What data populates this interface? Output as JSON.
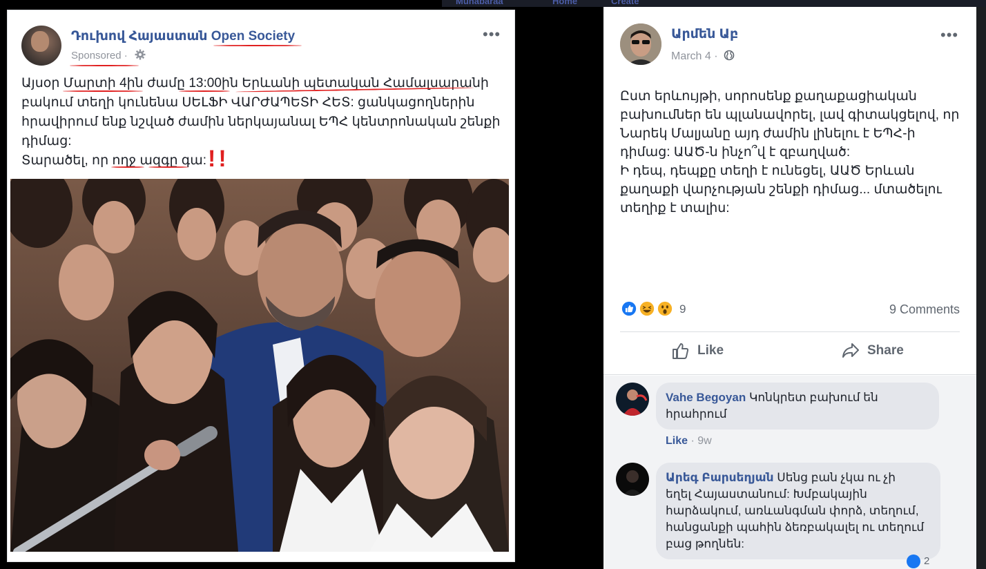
{
  "background_nav": {
    "items": [
      "Muhabaraa",
      "Home",
      "Create"
    ]
  },
  "left_post": {
    "page_name_part1": "Դուխով Հայաստան",
    "page_name_part2": "Open Society",
    "sponsored": "Sponsored",
    "sponsored_sep": "·",
    "more": "•••",
    "text_lines": [
      "Այսօր Մարտի 4ին ժամը 13:00ին Երևանի պետական Համալսարանի",
      "բակում տեղի կունենա ՍԵԼՖԻ ՎԱՐԺԱՊԵՏԻ ՀԵՏ: ցանկացողներին",
      "հրավիրում ենք նշված ժամին ներկայանալ ԵՊՀ կենտրոնական շենքի",
      "դիմաց:",
      "Տարածել, որ ողջ ազգը գա:"
    ],
    "exclamation": "!!",
    "annotation_color": "#e02020"
  },
  "right_post": {
    "author": "Արմեն Աբ",
    "date": "March 4",
    "date_sep": "·",
    "more": "•••",
    "text_lines": [
      "Ըստ երևույթի, սորոսենք քաղաքացիական",
      "բախումներ են պլանավորել, լավ գիտակցելով, որ",
      "Նարեկ Մալյանը այդ ժամին լինելու է ԵՊՀ-ի",
      "դիմաց: ԱԱԾ-ն ինչո՞վ է զբաղված:",
      "Ի դեպ, դեպքը տեղի է ունեցել, ԱԱԾ Երևան",
      "քաղաքի վարչության շենքի դիմաց... մտածելու",
      "տեղիք է տալիս:"
    ],
    "reactions": [
      "like",
      "haha",
      "wow"
    ],
    "reaction_count": "9",
    "comments_count": "9 Comments",
    "like_label": "Like",
    "share_label": "Share",
    "comments": [
      {
        "author": "Vahe Begoyan",
        "text_line1": "Կոնկրետ բախում են",
        "text_line2": "հրահրում",
        "like": "Like",
        "sep": "·",
        "time": "9w"
      },
      {
        "author": "Արեգ Բարսեղյան",
        "text_lines": [
          "Սենց բան չկա ու չի",
          "եղել Հայաստանում: Խմբակային",
          "հարձակում, առևանգման փորձ, տեղում,",
          "հանցանքի պահին ձեռբակալել ու տեղում",
          "բաց թողնեն:"
        ],
        "reaction_count": "2"
      }
    ]
  },
  "colors": {
    "link_blue": "#385898",
    "meta_gray": "#90949c",
    "like_blue": "#1877f2",
    "haha_yellow": "#f7b125"
  }
}
